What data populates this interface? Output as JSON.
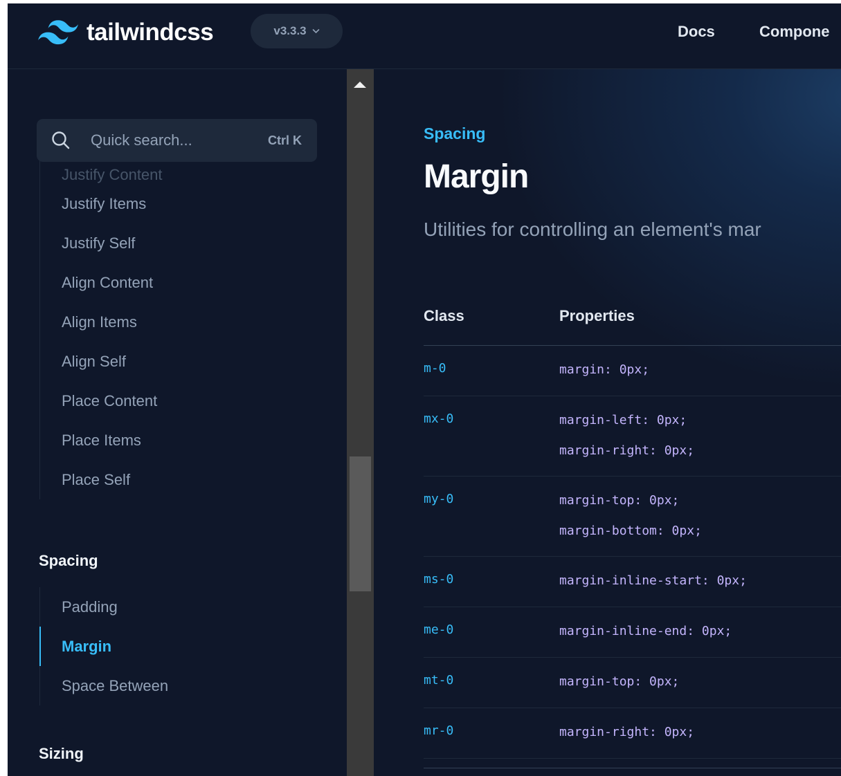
{
  "header": {
    "logo_text": "tailwindcss",
    "version": "v3.3.3",
    "nav": [
      "Docs",
      "Compone"
    ]
  },
  "sidebar": {
    "search_placeholder": "Quick search...",
    "search_shortcut": "Ctrl K",
    "layout_items": [
      "Justify Content",
      "Justify Items",
      "Justify Self",
      "Align Content",
      "Align Items",
      "Align Self",
      "Place Content",
      "Place Items",
      "Place Self"
    ],
    "spacing_title": "Spacing",
    "spacing_items": [
      "Padding",
      "Margin",
      "Space Between"
    ],
    "sizing_title": "Sizing"
  },
  "main": {
    "eyebrow": "Spacing",
    "title": "Margin",
    "description": "Utilities for controlling an element's mar",
    "table": {
      "headers": [
        "Class",
        "Properties"
      ],
      "rows": [
        {
          "class": "m-0",
          "props": [
            "margin: 0px;"
          ]
        },
        {
          "class": "mx-0",
          "props": [
            "margin-left: 0px;",
            "margin-right: 0px;"
          ]
        },
        {
          "class": "my-0",
          "props": [
            "margin-top: 0px;",
            "margin-bottom: 0px;"
          ]
        },
        {
          "class": "ms-0",
          "props": [
            "margin-inline-start: 0px;"
          ]
        },
        {
          "class": "me-0",
          "props": [
            "margin-inline-end: 0px;"
          ]
        },
        {
          "class": "mt-0",
          "props": [
            "margin-top: 0px;"
          ]
        },
        {
          "class": "mr-0",
          "props": [
            "margin-right: 0px;"
          ]
        }
      ]
    }
  },
  "colors": {
    "background": "#0f172a",
    "accent": "#38bdf8",
    "code_property": "#c4b5fd"
  }
}
